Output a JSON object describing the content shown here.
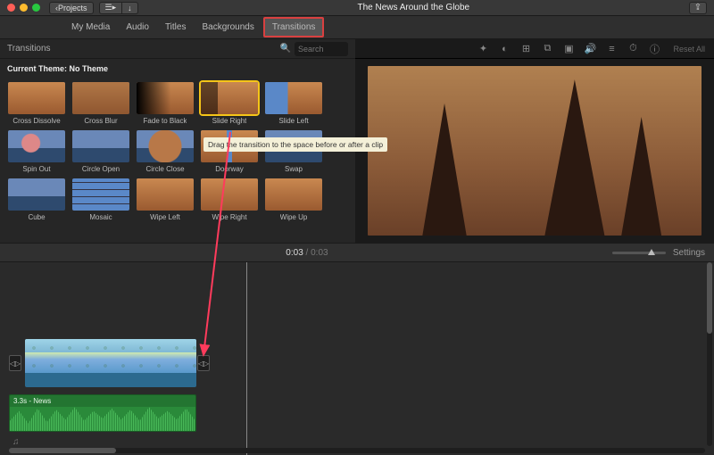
{
  "window": {
    "title": "The News Around the Globe",
    "back_label": "Projects"
  },
  "nav": {
    "items": [
      {
        "key": "my-media",
        "label": "My Media"
      },
      {
        "key": "audio",
        "label": "Audio"
      },
      {
        "key": "titles",
        "label": "Titles"
      },
      {
        "key": "backgrounds",
        "label": "Backgrounds"
      },
      {
        "key": "transitions",
        "label": "Transitions",
        "active": true
      }
    ]
  },
  "browser": {
    "title": "Transitions",
    "search_placeholder": "Search",
    "theme_prefix": "Current Theme:",
    "theme_value": "No Theme",
    "tooltip": "Drag the transition to the space before or after a clip",
    "transitions_row1": [
      {
        "label": "Cross Dissolve"
      },
      {
        "label": "Cross Blur"
      },
      {
        "label": "Fade to Black"
      },
      {
        "label": "Slide Right",
        "selected": true
      },
      {
        "label": "Slide Left"
      }
    ],
    "transitions_row2": [
      {
        "label": "Spin Out"
      },
      {
        "label": "Circle Open"
      },
      {
        "label": "Circle Close"
      },
      {
        "label": "Doorway"
      },
      {
        "label": "Swap"
      }
    ],
    "transitions_row3": [
      {
        "label": "Cube"
      },
      {
        "label": "Mosaic"
      },
      {
        "label": "Wipe Left"
      },
      {
        "label": "Wipe Right"
      },
      {
        "label": "Wipe Up"
      }
    ]
  },
  "viewer": {
    "reset_label": "Reset All",
    "tool_icons": [
      "wand",
      "color",
      "crop",
      "stabilize",
      "volume",
      "eq",
      "speed",
      "info"
    ]
  },
  "timebar": {
    "current": "0:03",
    "duration": "0:03",
    "settings_label": "Settings"
  },
  "timeline": {
    "audio_clip_label": "3.3s - News",
    "transition_handle_glyph": "⧐"
  },
  "colors": {
    "highlight_red": "#d94040",
    "selection_yellow": "#f5c518"
  }
}
